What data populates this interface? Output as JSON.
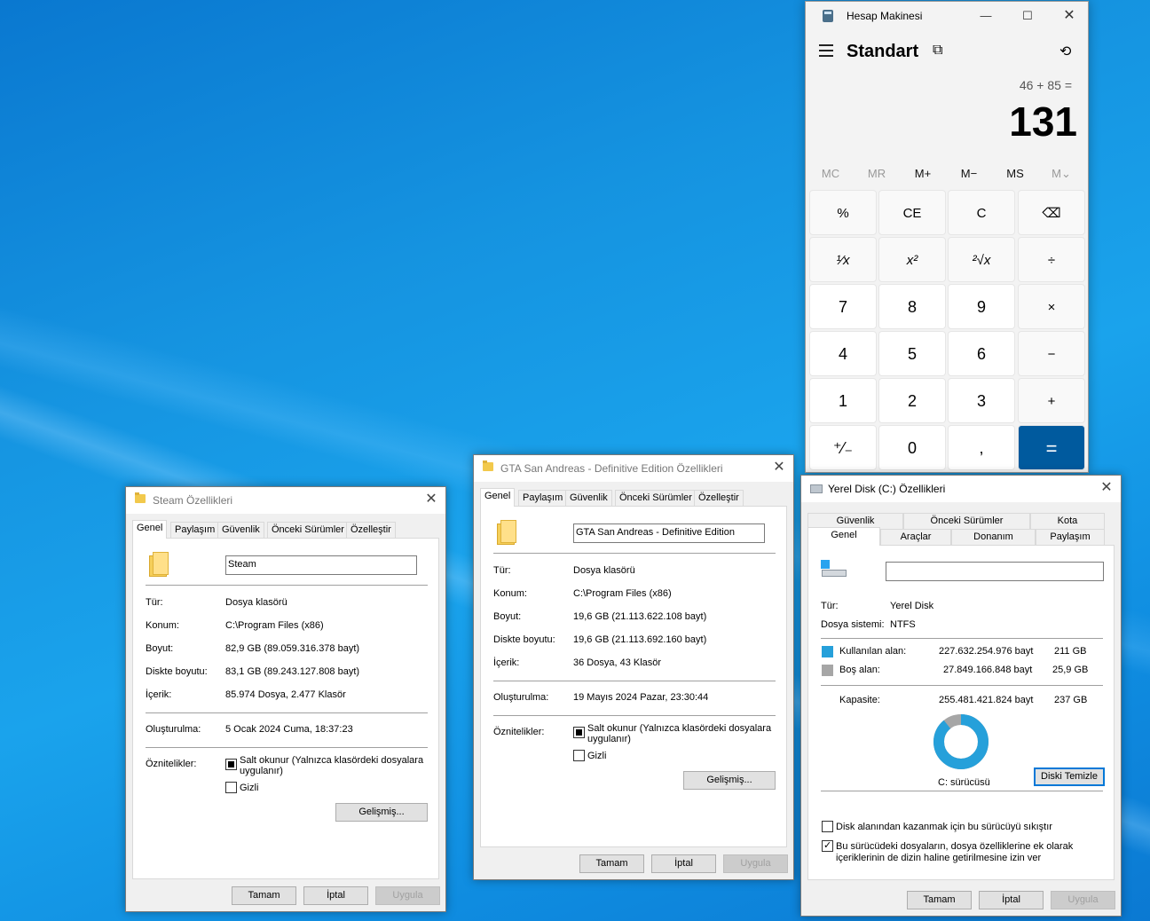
{
  "calculator": {
    "title": "Hesap Makinesi",
    "mode": "Standart",
    "expression": "46 + 85 =",
    "display": "131",
    "memory": [
      "MC",
      "MR",
      "M+",
      "M−",
      "MS",
      "M⌄"
    ],
    "keys": [
      [
        "%",
        "CE",
        "C",
        "⌫"
      ],
      [
        "¹⁄x",
        "x²",
        "²√x",
        "÷"
      ],
      [
        "7",
        "8",
        "9",
        "×"
      ],
      [
        "4",
        "5",
        "6",
        "−"
      ],
      [
        "1",
        "2",
        "3",
        "+"
      ],
      [
        "⁺⁄₋",
        "0",
        ",",
        "="
      ]
    ]
  },
  "steam": {
    "title": "Steam Özellikleri",
    "tabs": [
      "Genel",
      "Paylaşım",
      "Güvenlik",
      "Önceki Sürümler",
      "Özelleştir"
    ],
    "name": "Steam",
    "type_label": "Tür:",
    "type": "Dosya klasörü",
    "location_label": "Konum:",
    "location": "C:\\Program Files (x86)",
    "size_label": "Boyut:",
    "size": "82,9 GB (89.059.316.378 bayt)",
    "disk_size_label": "Diskte boyutu:",
    "disk_size": "83,1 GB (89.243.127.808 bayt)",
    "contents_label": "İçerik:",
    "contents": "85.974 Dosya, 2.477 Klasör",
    "created_label": "Oluşturulma:",
    "created": "5 Ocak 2024 Cuma, 18:37:23",
    "attributes_label": "Öznitelikler:",
    "readonly": "Salt okunur (Yalnızca klasördeki dosyalara uygulanır)",
    "hidden": "Gizli",
    "advanced": "Gelişmiş...",
    "ok": "Tamam",
    "cancel": "İptal",
    "apply": "Uygula"
  },
  "gta": {
    "title": "GTA San Andreas - Definitive Edition Özellikleri",
    "tabs": [
      "Genel",
      "Paylaşım",
      "Güvenlik",
      "Önceki Sürümler",
      "Özelleştir"
    ],
    "name": "GTA San Andreas - Definitive Edition",
    "type_label": "Tür:",
    "type": "Dosya klasörü",
    "location_label": "Konum:",
    "location": "C:\\Program Files (x86)",
    "size_label": "Boyut:",
    "size": "19,6 GB (21.113.622.108 bayt)",
    "disk_size_label": "Diskte boyutu:",
    "disk_size": "19,6 GB (21.113.692.160 bayt)",
    "contents_label": "İçerik:",
    "contents": "36 Dosya, 43 Klasör",
    "created_label": "Oluşturulma:",
    "created": "19 Mayıs 2024 Pazar, 23:30:44",
    "attributes_label": "Öznitelikler:",
    "readonly": "Salt okunur (Yalnızca klasördeki dosyalara uygulanır)",
    "hidden": "Gizli",
    "advanced": "Gelişmiş...",
    "ok": "Tamam",
    "cancel": "İptal",
    "apply": "Uygula"
  },
  "disk": {
    "title": "Yerel Disk (C:) Özellikleri",
    "tabs_top": [
      "Güvenlik",
      "Önceki Sürümler",
      "Kota"
    ],
    "tabs_bottom": [
      "Genel",
      "Araçlar",
      "Donanım",
      "Paylaşım"
    ],
    "name": "",
    "type_label": "Tür:",
    "type": "Yerel Disk",
    "fs_label": "Dosya sistemi:",
    "fs": "NTFS",
    "used_label": "Kullanılan alan:",
    "used_bytes": "227.632.254.976 bayt",
    "used_gb": "211 GB",
    "free_label": "Boş alan:",
    "free_bytes": "27.849.166.848 bayt",
    "free_gb": "25,9 GB",
    "capacity_label": "Kapasite:",
    "capacity_bytes": "255.481.421.824 bayt",
    "capacity_gb": "237 GB",
    "used_fraction": 0.891,
    "used_color": "#26a0da",
    "free_color": "#a6a6a6",
    "drive_label": "C: sürücüsü",
    "cleanup": "Diski Temizle",
    "compress": "Disk alanından kazanmak için bu sürücüyü sıkıştır",
    "index": "Bu sürücüdeki dosyaların, dosya özelliklerine ek olarak içeriklerinin de dizin haline getirilmesine izin ver",
    "ok": "Tamam",
    "cancel": "İptal",
    "apply": "Uygula"
  }
}
